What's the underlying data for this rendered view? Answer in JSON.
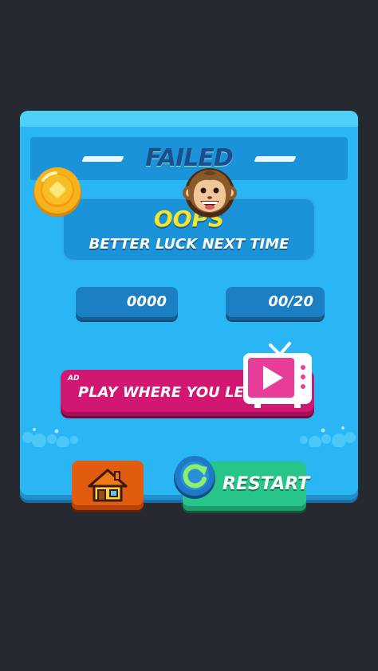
{
  "dialog": {
    "title": "FAILED",
    "headline": "OOPS",
    "subheadline": "BETTER LUCK NEXT TIME"
  },
  "stats": {
    "coins": "0000",
    "coin_icon": "coin-icon",
    "monkeys": "00/20",
    "monkey_icon": "monkey-face-icon"
  },
  "ad_offer": {
    "tag": "AD",
    "label": "PLAY WHERE YOU LEFT",
    "icon": "tv-play-icon"
  },
  "actions": {
    "home_icon": "house-icon",
    "restart_label": "RESTART",
    "restart_icon": "refresh-arrow-icon"
  },
  "colors": {
    "background": "#262a30",
    "panel": "#2ab6f5",
    "title": "#1c4f8a",
    "headline": "#f6e52b",
    "ad_button": "#d21772",
    "home_button": "#e25c10",
    "restart_button": "#27c58a"
  }
}
